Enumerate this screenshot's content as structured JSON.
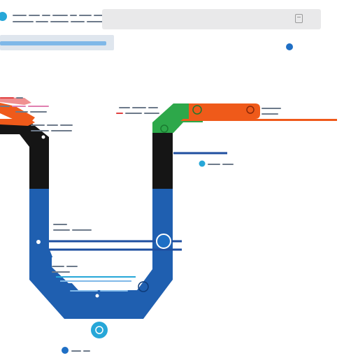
{
  "diagram": {
    "colors": {
      "green": "#2da84a",
      "orange": "#ef5a1a",
      "black": "#151515",
      "blue": "#1f5fb0",
      "accent_blue": "#1f6fc5",
      "cyan": "#27a7d8",
      "light_blue": "#7fb8e8",
      "red": "#e04040",
      "pink": "#e07fb0"
    },
    "icons": {
      "top_right_icon": "document-icon",
      "node_upper_right": "circle-node-icon",
      "node_middle": "circle-node-icon",
      "node_lower": "circle-node-icon",
      "node_bottom": "circle-node-icon"
    }
  }
}
